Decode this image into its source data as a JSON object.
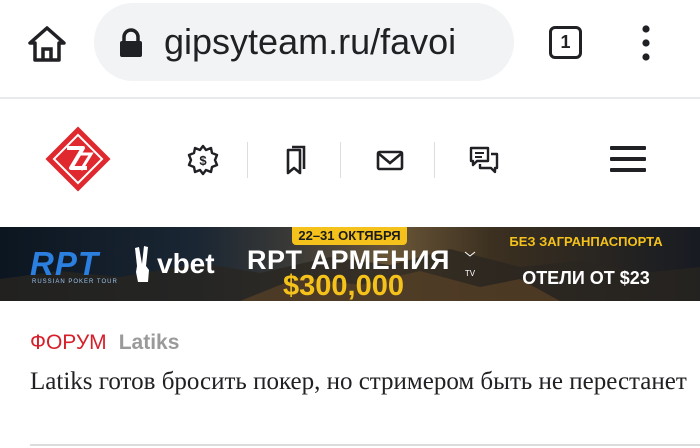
{
  "browser": {
    "url": "gipsyteam.ru/favoi",
    "tab_count": "1"
  },
  "site_nav": {
    "icons": [
      "settings-badge-icon",
      "bookmarks-icon",
      "mail-icon",
      "chat-icon",
      "hamburger-menu-icon"
    ],
    "logo": "gipsyteam-logo"
  },
  "banner": {
    "brand": "RPT",
    "brand_sub": "RUSSIAN POKER TOUR",
    "partner": "vbet",
    "dates": "22–31 ОКТЯБРЯ",
    "event": "RPT АРМЕНИЯ",
    "tv_mark": "TV",
    "prize": "$300,000",
    "promo_line1": "БЕЗ ЗАГРАНПАСПОРТА",
    "promo_line2": "ОТЕЛИ ОТ $23",
    "colors": {
      "accent": "#f4c21b",
      "brand_blue": "#2a7fe0"
    }
  },
  "article": {
    "section": "ФОРУМ",
    "author": "Latiks",
    "title": "Latiks готов бросить покер, но стримером быть не перестанет"
  },
  "colors": {
    "section_red": "#d61f2b",
    "author_gray": "#9a9a9a",
    "logo_red": "#e0282f"
  }
}
